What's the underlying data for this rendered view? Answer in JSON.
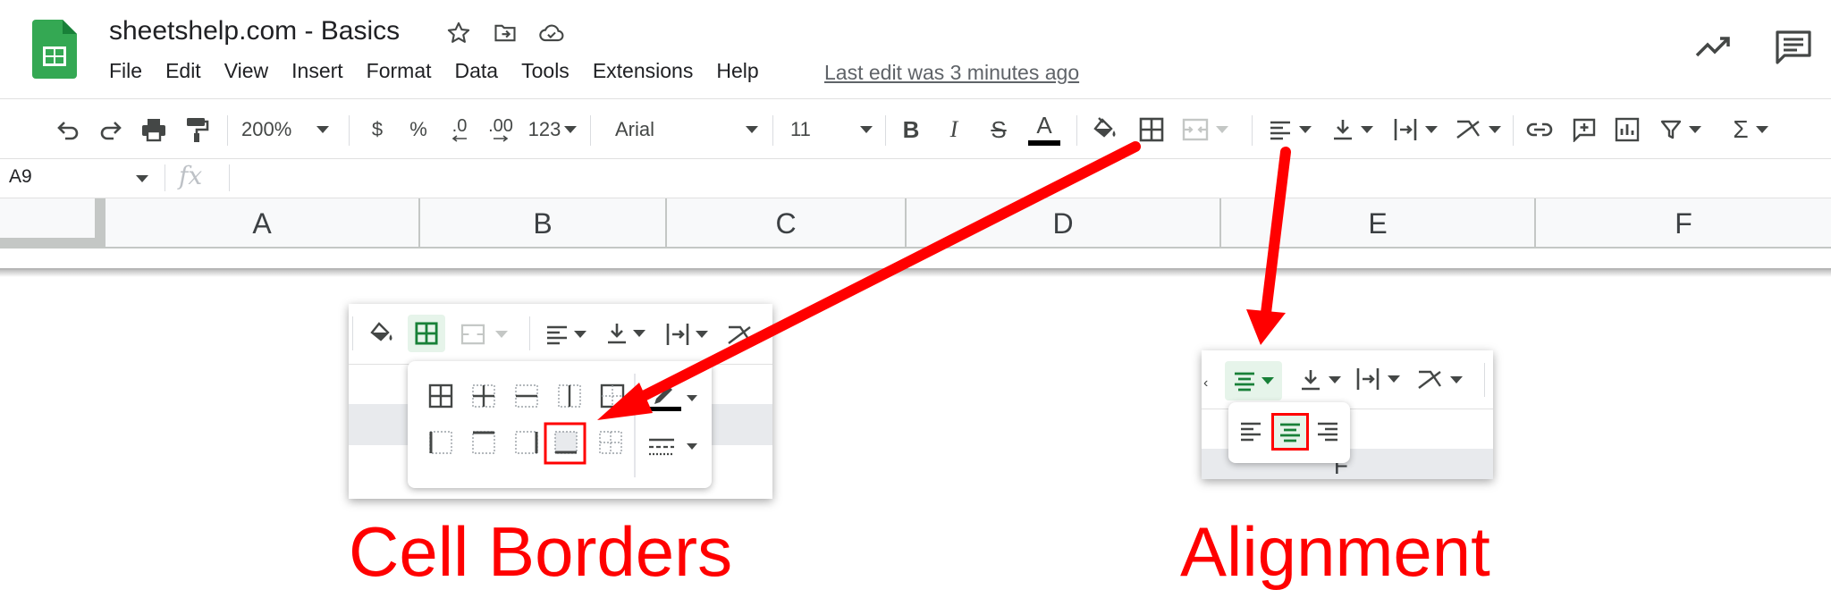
{
  "doc": {
    "title": "sheetshelp.com - Basics",
    "last_edit": "Last edit was 3 minutes ago"
  },
  "menu": [
    "File",
    "Edit",
    "View",
    "Insert",
    "Format",
    "Data",
    "Tools",
    "Extensions",
    "Help"
  ],
  "toolbar": {
    "zoom": "200%",
    "currency": "$",
    "percent": "%",
    "decrease_decimal": ".0",
    "increase_decimal": ".00",
    "more_formats": "123",
    "font": "Arial",
    "font_size": "11",
    "bold": "B",
    "italic": "I",
    "strikethrough": "S",
    "text_color": "A",
    "sum": "Σ"
  },
  "formula_bar": {
    "cell_ref": "A9",
    "fx": "fx"
  },
  "columns": [
    "A",
    "B",
    "C",
    "D",
    "E",
    "F"
  ],
  "captions": {
    "borders": "Cell Borders",
    "alignment": "Alignment"
  },
  "inset_alignment": {
    "partial_column_label": "F"
  },
  "colors": {
    "annotation_red": "#ff0000",
    "sheets_green": "#188038",
    "selected_bg": "#e6f4ea",
    "header_bg": "#f8f9fa"
  }
}
